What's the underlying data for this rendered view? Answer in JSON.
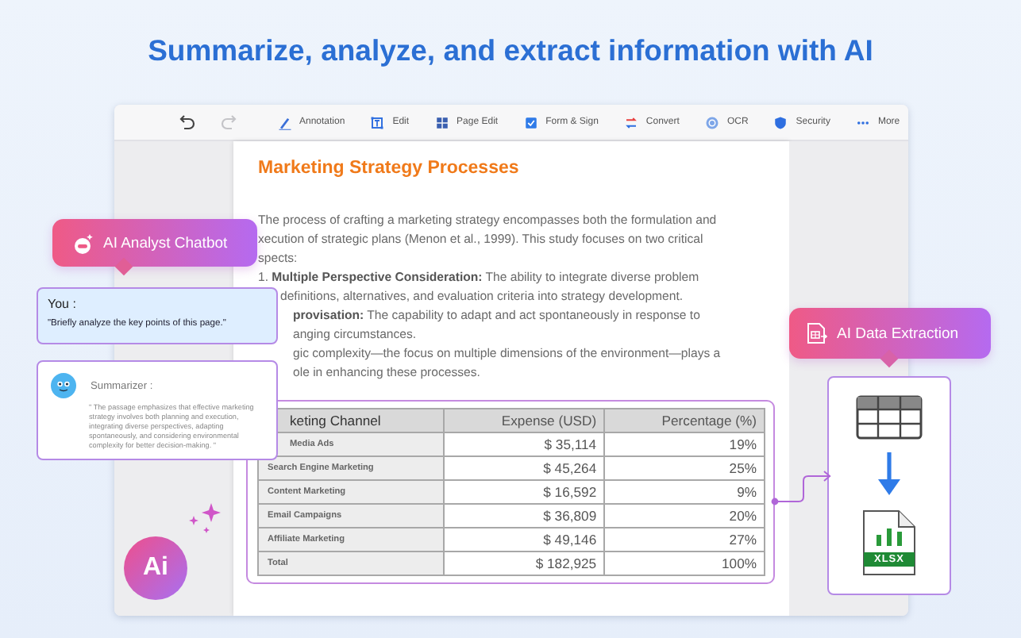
{
  "headline": "Summarize, analyze, and extract information with AI",
  "toolbar": {
    "history": [
      {
        "kind": "undo",
        "disabled": false
      },
      {
        "kind": "redo",
        "disabled": true
      }
    ],
    "tools": [
      {
        "kind": "pen",
        "label": "Annotation"
      },
      {
        "kind": "frame",
        "label": "Edit"
      },
      {
        "kind": "grid",
        "label": "Page Edit"
      },
      {
        "kind": "check",
        "label": "Form & Sign"
      },
      {
        "kind": "convert",
        "label": "Convert"
      },
      {
        "kind": "ocr",
        "label": "OCR"
      },
      {
        "kind": "shield",
        "label": "Security"
      },
      {
        "kind": "dots",
        "label": "More"
      }
    ]
  },
  "document": {
    "title": "Marketing Strategy Processes",
    "lines": [
      {
        "kind": "full",
        "text": "The process of crafting a marketing strategy encompasses both the formulation and"
      },
      {
        "kind": "full",
        "text": "xecution of strategic plans (Menon et al., 1999). This study focuses on two critical"
      },
      {
        "kind": "full",
        "text": "spects:"
      },
      {
        "kind": "full",
        "text": "1. **Multiple Perspective Consideration:** The ability to integrate diverse problem"
      },
      {
        "kind": "hanging",
        "text": "definitions, alternatives, and evaluation criteria into strategy development."
      },
      {
        "kind": "covered",
        "text": "**provisation:** The capability to adapt and act spontaneously in response to"
      },
      {
        "kind": "covered",
        "text": "anging circumstances."
      },
      {
        "kind": "covered",
        "text": "gic complexity—the focus on multiple dimensions of the environment—plays a"
      },
      {
        "kind": "covered",
        "text": "ole in enhancing these processes."
      }
    ],
    "table": {
      "columns": [
        "keting Channel",
        "Expense (USD)",
        "Percentage (%)"
      ],
      "rows": [
        [
          "Media Ads",
          "$ 35,114",
          "19%"
        ],
        [
          "Search Engine Marketing",
          "$ 45,264",
          "25%"
        ],
        [
          "Content Marketing",
          "$ 16,592",
          "9%"
        ],
        [
          "Email Campaigns",
          "$ 36,809",
          "20%"
        ],
        [
          "Affiliate Marketing",
          "$ 49,146",
          "27%"
        ],
        [
          "Total",
          "$ 182,925",
          "100%"
        ]
      ]
    }
  },
  "chatbot": {
    "title": "AI Analyst Chatbot",
    "user": {
      "name": "You :",
      "message": "\"Briefly analyze the key points of this page.\""
    },
    "reply": {
      "name": "Summarizer :",
      "message": "\" The passage emphasizes that effective marketing strategy involves both planning and execution, integrating diverse perspectives, adapting spontaneously, and considering environmental complexity for better decision-making. \""
    }
  },
  "extraction": {
    "title": "AI Data Extraction",
    "file_label": "XLSX"
  },
  "ai_badge": {
    "label": "Ai"
  }
}
